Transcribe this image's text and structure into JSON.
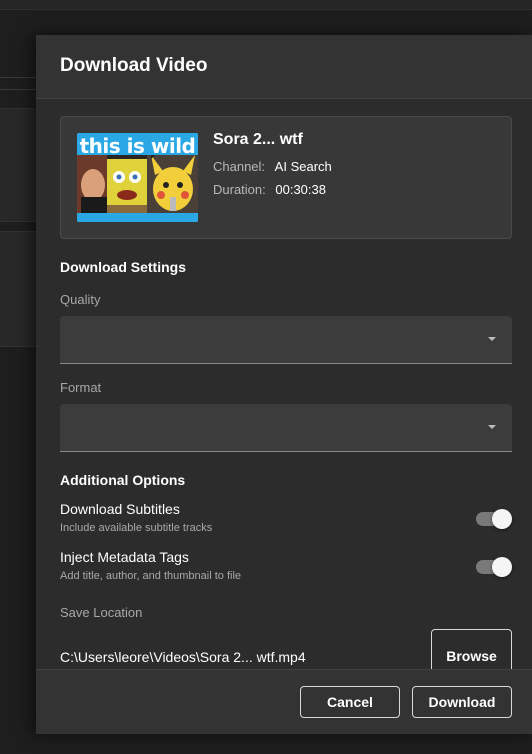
{
  "dialog": {
    "title": "Download Video"
  },
  "video": {
    "thumbnail_caption": "this is wild",
    "title": "Sora 2... wtf",
    "channel_label": "Channel:",
    "channel": "AI Search",
    "duration_label": "Duration:",
    "duration": "00:30:38"
  },
  "settings": {
    "section_title": "Download Settings",
    "quality_label": "Quality",
    "quality_value": "",
    "format_label": "Format",
    "format_value": ""
  },
  "options": {
    "section_title": "Additional Options",
    "subtitles": {
      "title": "Download Subtitles",
      "description": "Include available subtitle tracks",
      "enabled": true
    },
    "metadata": {
      "title": "Inject Metadata Tags",
      "description": "Add title, author, and thumbnail to file",
      "enabled": true
    }
  },
  "save": {
    "label": "Save Location",
    "path": "C:\\Users\\leore\\Videos\\Sora 2... wtf.mp4",
    "browse_label": "Browse"
  },
  "footer": {
    "cancel_label": "Cancel",
    "download_label": "Download"
  },
  "colors": {
    "dialog_bg": "#2c2c2c",
    "header_bg": "#333333",
    "card_bg": "#383838",
    "field_bg": "#3c3c3c",
    "thumbnail_accent": "#2aa8e6"
  }
}
